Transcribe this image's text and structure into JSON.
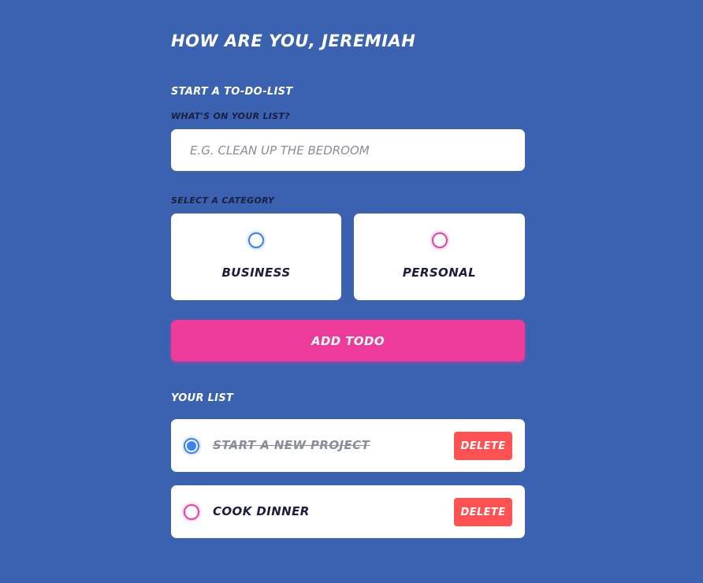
{
  "greeting": "How are you, Jeremiah",
  "create": {
    "title": "Start a to-do-list",
    "input_label": "What's on your list?",
    "input_placeholder": "e.g. clean up the bedroom",
    "input_value": "",
    "category_label": "Select a category",
    "categories": [
      {
        "label": "Business",
        "color": "#3a82f7",
        "selected": false
      },
      {
        "label": "Personal",
        "color": "#ea40a4",
        "selected": false
      }
    ],
    "add_button_label": "Add todo",
    "add_button_color": "#ee3a9b"
  },
  "list": {
    "title": "Your List",
    "items": [
      {
        "text": "Start a new project",
        "category": "Business",
        "done": true,
        "delete_label": "Delete"
      },
      {
        "text": "Cook dinner",
        "category": "Personal",
        "done": false,
        "delete_label": "Delete"
      }
    ]
  },
  "colors": {
    "background": "#3a62b0",
    "business": "#3a82f7",
    "personal": "#ea40a4",
    "delete": "#ff5252"
  }
}
